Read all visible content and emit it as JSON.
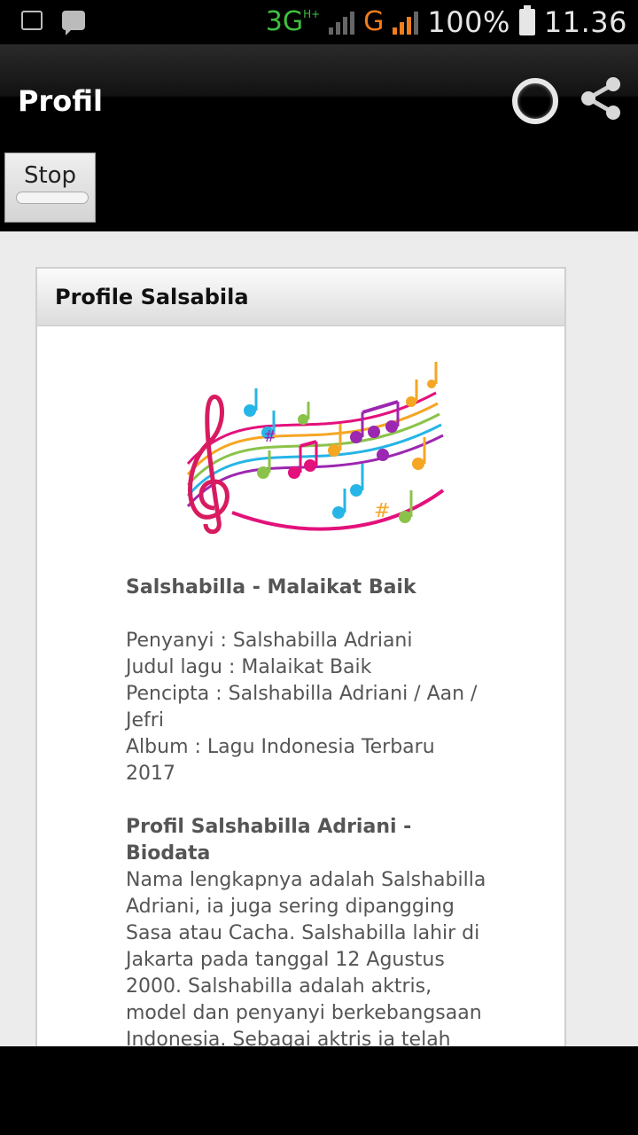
{
  "status_bar": {
    "network_3g": "3G",
    "network_hplus": "H+",
    "network_g": "G",
    "battery": "100%",
    "time": "11.36"
  },
  "action_bar": {
    "title": "Profil",
    "icons": [
      "refresh-ring-icon",
      "share-icon"
    ]
  },
  "stop_button": {
    "label": "Stop"
  },
  "card": {
    "title": "Profile Salsabila",
    "image_icon": "music-notes-icon",
    "song_heading": "Salshabilla - Malaikat Baik",
    "details": [
      "Penyanyi : Salshabilla Adriani",
      "Judul lagu : Malaikat Baik",
      "Pencipta : Salshabilla Adriani / Aan / Jefri",
      "Album : Lagu Indonesia Terbaru 2017"
    ],
    "bio_heading": "Profil Salshabilla Adriani - Biodata",
    "bio_text": "Nama lengkapnya adalah Salshabilla Adriani, ia juga sering dipangging Sasa atau Cacha. Salshabilla lahir di Jakarta pada tanggal 12 Agustus 2000. Salshabilla adalah aktris, model dan penyanyi berkebangsaan Indonesia. Sebagai aktris ia telah membintangi sejumlah sinetron dan"
  },
  "colors": {
    "accent_green": "#3fbf3f",
    "accent_orange": "#f07d1d",
    "content_bg": "#ececec"
  }
}
